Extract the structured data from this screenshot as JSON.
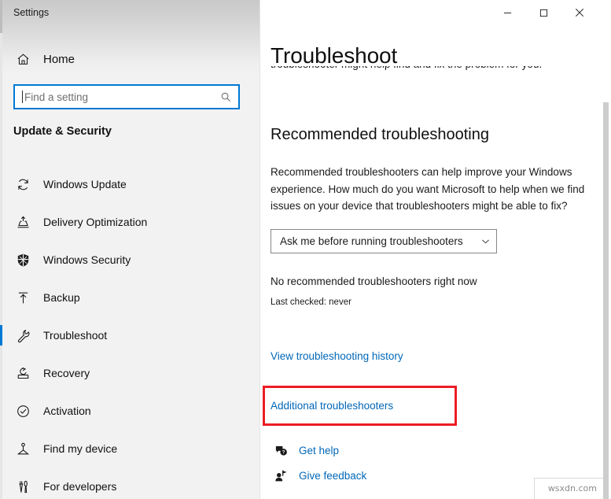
{
  "window": {
    "title": "Settings",
    "controls": {
      "minimize": "minimize",
      "maximize": "maximize",
      "close": "close"
    }
  },
  "sidebar": {
    "home_label": "Home",
    "home_icon": "home-icon",
    "search": {
      "placeholder": "Find a setting",
      "value": "",
      "icon": "search-icon"
    },
    "group_title": "Update & Security",
    "accent_color": "#0078d4",
    "items": [
      {
        "label": "Windows Update",
        "icon": "refresh-icon",
        "selected": false
      },
      {
        "label": "Delivery Optimization",
        "icon": "delivery-icon",
        "selected": false
      },
      {
        "label": "Windows Security",
        "icon": "shield-icon",
        "selected": false
      },
      {
        "label": "Backup",
        "icon": "upload-arrow-icon",
        "selected": false
      },
      {
        "label": "Troubleshoot",
        "icon": "wrench-icon",
        "selected": true
      },
      {
        "label": "Recovery",
        "icon": "recovery-icon",
        "selected": false
      },
      {
        "label": "Activation",
        "icon": "check-circle-icon",
        "selected": false
      },
      {
        "label": "Find my device",
        "icon": "find-device-icon",
        "selected": false
      },
      {
        "label": "For developers",
        "icon": "tools-icon",
        "selected": false
      }
    ]
  },
  "main": {
    "page_title": "Troubleshoot",
    "intro_clipped_text": "troubleshooter might help find and fix the problem for you.",
    "section": {
      "title": "Recommended troubleshooting",
      "body": "Recommended troubleshooters can help improve your Windows experience. How much do you want Microsoft to help when we find issues on your device that troubleshooters might be able to fix?"
    },
    "dropdown": {
      "value": "Ask me before running troubleshooters",
      "chevron_icon": "chevron-down-icon"
    },
    "status": {
      "primary": "No recommended troubleshooters right now",
      "secondary": "Last checked: never"
    },
    "links": {
      "history": "View troubleshooting history",
      "additional": "Additional troubleshooters",
      "link_color": "#0067b8"
    },
    "highlight": {
      "color": "#ec1c24",
      "target": "Additional troubleshooters"
    },
    "footer": [
      {
        "label": "Get help",
        "icon": "help-bubble-icon"
      },
      {
        "label": "Give feedback",
        "icon": "feedback-person-icon"
      }
    ]
  },
  "watermark": {
    "text": "wsxdn.com"
  }
}
